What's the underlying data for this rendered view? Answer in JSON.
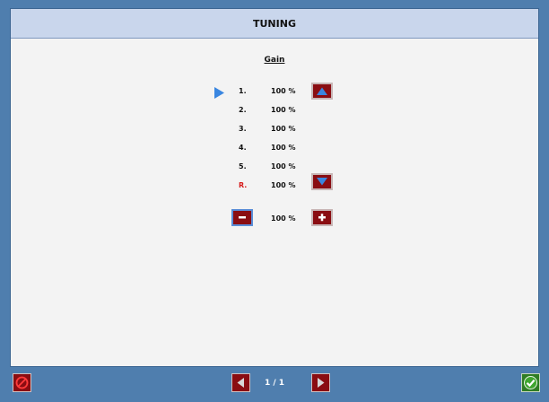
{
  "header": {
    "title": "TUNING"
  },
  "gain": {
    "heading": "Gain",
    "rows": [
      {
        "label": "1.",
        "value": "100 %"
      },
      {
        "label": "2.",
        "value": "100 %"
      },
      {
        "label": "3.",
        "value": "100 %"
      },
      {
        "label": "4.",
        "value": "100 %"
      },
      {
        "label": "5.",
        "value": "100 %"
      },
      {
        "label": "R.",
        "value": "100 %"
      }
    ],
    "selected_row": 1,
    "adjust_value": "100 %"
  },
  "footer": {
    "page_indicator": "1 / 1"
  },
  "icons": {
    "pointer": "play-right-icon",
    "up": "triangle-up-icon",
    "down": "triangle-down-icon",
    "minus": "minus-icon",
    "plus": "plus-icon",
    "prev": "chevron-left-icon",
    "next": "chevron-right-icon",
    "cancel": "cancel-icon",
    "ok": "check-icon"
  },
  "colors": {
    "background": "#4f7eae",
    "panel": "#f3f3f3",
    "header": "#c9d6ec",
    "button": "#8a0d12",
    "accent_blue": "#3a86e0",
    "reference_label": "#d61a1a",
    "ok_green": "#2f7d24"
  }
}
